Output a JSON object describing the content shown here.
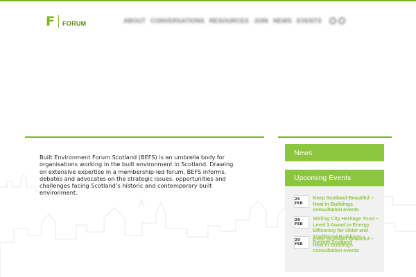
{
  "header": {
    "logo_letter": "F",
    "logo_word": "FORUM",
    "nav_items": [
      "ABOUT",
      "CONVERSATIONS",
      "RESOURCES",
      "JOIN",
      "NEWS",
      "EVENTS"
    ],
    "nav_icons": [
      "search-icon",
      "social-icon"
    ]
  },
  "colors": {
    "accent": "#7ab51d",
    "panel_green": "#8cc63f",
    "panel_bg": "#f1f1f1"
  },
  "intro": {
    "text": "Built Environment Forum Scotland (BEFS) is an umbrella body for organisations working in the built environment in Scotland. Drawing on extensive expertise in a membership-led forum, BEFS informs, debates and advocates on the strategic issues, opportunities and challenges facing Scotland’s historic and contemporary built environment."
  },
  "sidebar": {
    "news_label": "News",
    "events_label": "Upcoming Events",
    "events": [
      {
        "date": "25 FEB",
        "title": "Keep Scotland Beautiful – Heat in Buildings consultation events"
      },
      {
        "date": "28 FEB",
        "title": "Stirling City Heritage Trust – Level 3 Award in Energy Efficiency for Older and Traditional Buildings – Retrofit Scotland"
      },
      {
        "date": "29 FEB",
        "title": "Keep Scotland Beautiful – Heat in Buildings consultation events"
      }
    ]
  }
}
